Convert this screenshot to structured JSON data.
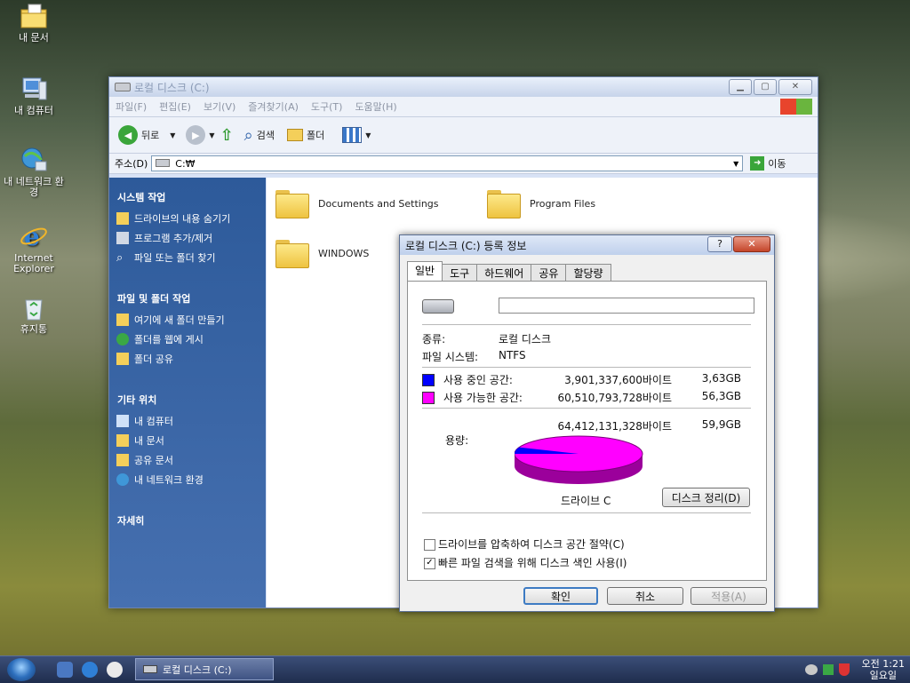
{
  "desktop": {
    "icons": [
      {
        "label": "내 문서"
      },
      {
        "label": "내 컴퓨터"
      },
      {
        "label": "내 네트워크 환경"
      },
      {
        "label": "Internet Explorer"
      },
      {
        "label": "휴지통"
      }
    ]
  },
  "explorer": {
    "title": "로컬 디스크 (C:)",
    "menu": [
      "파일(F)",
      "편집(E)",
      "보기(V)",
      "즐겨찾기(A)",
      "도구(T)",
      "도움말(H)"
    ],
    "toolbar": {
      "back": "뒤로",
      "search": "검색",
      "folders": "폴더"
    },
    "address": {
      "label": "주소(D)",
      "value": "C:₩",
      "go": "이동"
    },
    "tasks": {
      "system_header": "시스템 작업",
      "system_items": [
        "드라이브의 내용 숨기기",
        "프로그램 추가/제거",
        "파일 또는 폴더 찾기"
      ],
      "file_header": "파일 및 폴더 작업",
      "file_items": [
        "여기에 새 폴더 만들기",
        "폴더를 웹에 게시",
        "폴더 공유"
      ],
      "other_header": "기타 위치",
      "other_items": [
        "내 컴퓨터",
        "내 문서",
        "공유 문서",
        "내 네트워크 환경"
      ],
      "details_header": "자세히"
    },
    "folders": [
      "Documents and Settings",
      "Program Files",
      "WINDOWS"
    ]
  },
  "dialog": {
    "title": "로컬 디스크 (C:) 등록 정보",
    "tabs": [
      "일반",
      "도구",
      "하드웨어",
      "공유",
      "할당량"
    ],
    "label_value": "",
    "type_label": "종류:",
    "type_value": "로컬 디스크",
    "fs_label": "파일 시스템:",
    "fs_value": "NTFS",
    "used_label": "사용 중인 공간:",
    "used_bytes": "3,901,337,600바이트",
    "used_gb": "3,63GB",
    "free_label": "사용 가능한 공간:",
    "free_bytes": "60,510,793,728바이트",
    "free_gb": "56,3GB",
    "capacity_label": "용량:",
    "capacity_bytes": "64,412,131,328바이트",
    "capacity_gb": "59,9GB",
    "drive_label": "드라이브 C",
    "cleanup_btn": "디스크 정리(D)",
    "compress_label": "드라이브를 압축하여 디스크 공간 절약(C)",
    "index_label": "빠른 파일 검색을 위해 디스크 색인 사용(I)",
    "compress_checked": false,
    "index_checked": true,
    "ok": "확인",
    "cancel": "취소",
    "apply": "적용(A)",
    "colors": {
      "used": "#0000ff",
      "free": "#ff00ff"
    },
    "used_fraction": 0.0606
  },
  "taskbar": {
    "task": "로컬 디스크 (C:)",
    "time": "오전 1:21",
    "day": "일요일"
  }
}
